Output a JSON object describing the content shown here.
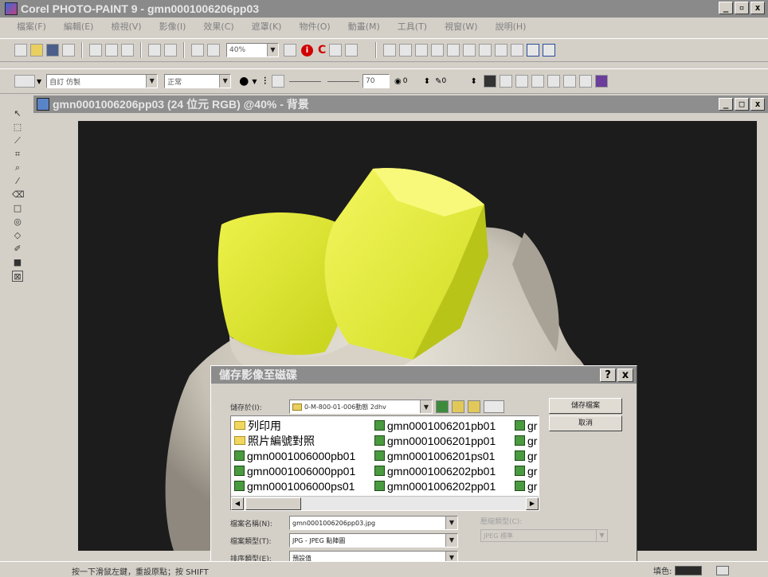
{
  "app": {
    "title": "Corel PHOTO-PAINT 9 - gmn0001006206pp03",
    "window_buttons": [
      "_",
      "▫",
      "x"
    ]
  },
  "menubar": {
    "items": [
      "檔案(F)",
      "編輯(E)",
      "檢視(V)",
      "影像(I)",
      "效果(C)",
      "遮罩(K)",
      "物件(O)",
      "動畫(M)",
      "工具(T)",
      "視窗(W)",
      "說明(H)"
    ]
  },
  "toolbar": {
    "zoom_value": "40%"
  },
  "property_bar": {
    "preset_value": "自訂 仿製",
    "mode_value": "正常",
    "size_value": "70",
    "transparency_value": "0",
    "soft_value": "0"
  },
  "document": {
    "title": "gmn0001006206pp03 (24 位元 RGB) @40% - 背景",
    "window_buttons": [
      "_",
      "□",
      "x"
    ]
  },
  "dialog": {
    "title": "儲存影像至磁碟",
    "help_button": "?",
    "close_button": "x",
    "save_in_label": "儲存於(I):",
    "save_in_value": "0-M-800-01-006動態 2dhv",
    "save_button": "儲存檔案",
    "cancel_button": "取消",
    "files_col1": [
      "列印用",
      "照片編號對照",
      "gmn0001006000pb01",
      "gmn0001006000pp01",
      "gmn0001006000ps01"
    ],
    "files_col2": [
      "gmn0001006201pb01",
      "gmn0001006201pp01",
      "gmn0001006201ps01",
      "gmn0001006202pb01",
      "gmn0001006202pp01"
    ],
    "files_col3": [
      "gr",
      "gr",
      "gr",
      "gr",
      "gr"
    ],
    "filename_label": "檔案名稱(N):",
    "filename_value": "gmn0001006206pp03.jpg",
    "filetype_label": "檔案類型(T):",
    "filetype_value": "JPG - JPEG 點陣圖",
    "sort_label": "排序類型(E):",
    "sort_value": "預設值",
    "compression_label": "壓縮類型(C):",
    "compression_value": "JPEG 標準"
  },
  "statusbar": {
    "hint": "按一下滑鼠左鍵，重設原點；按 SHIFT",
    "color_label": "填色:"
  },
  "colors": {
    "background": "#d4d0c8",
    "title_bar": "#8a8a8a",
    "canvas": "#1c1c1c",
    "crystal": "#d8e620"
  }
}
